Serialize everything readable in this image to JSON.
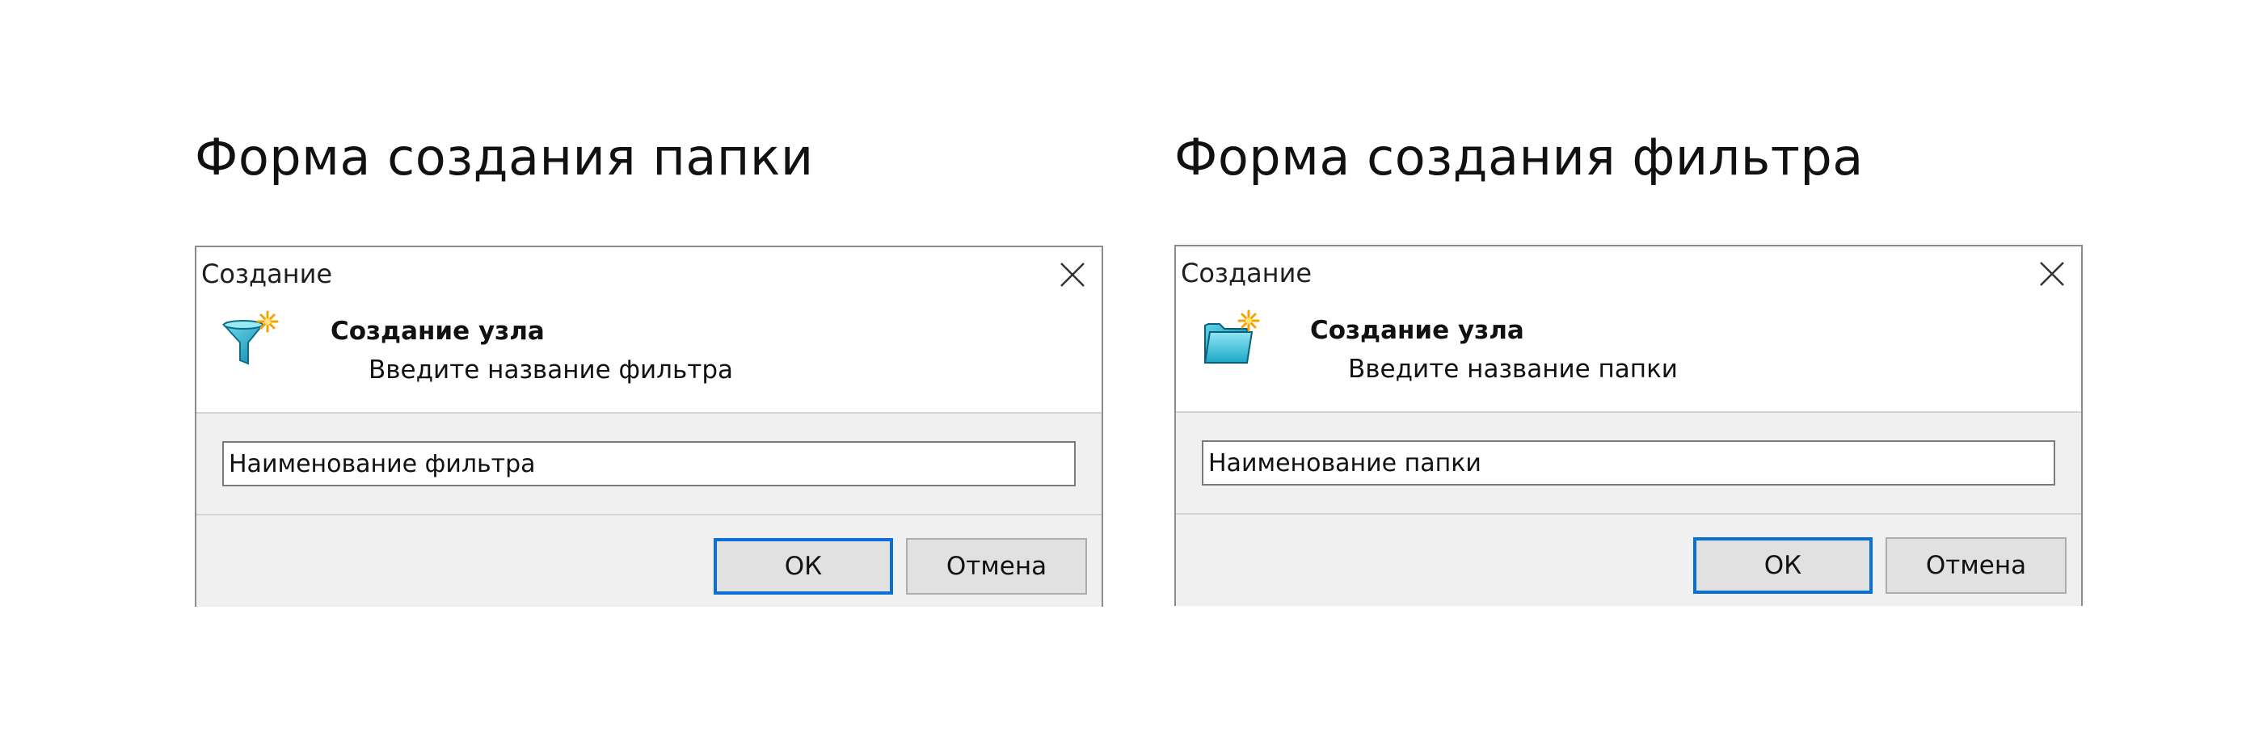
{
  "panels": [
    {
      "heading": "Форма создания папки",
      "dialog": {
        "title": "Создание",
        "header_title": "Создание узла",
        "header_subtitle": "Введите название фильтра",
        "input_value": "Наименование фильтра",
        "ok_label": "ОК",
        "cancel_label": "Отмена",
        "icon": "filter-icon"
      }
    },
    {
      "heading": "Форма создания фильтра",
      "dialog": {
        "title": "Создание",
        "header_title": "Создание узла",
        "header_subtitle": "Введите название папки",
        "input_value": "Наименование папки",
        "ok_label": "ОК",
        "cancel_label": "Отмена",
        "icon": "folder-icon"
      }
    }
  ],
  "colors": {
    "accent_border": "#0a6fd6",
    "icon_teal": "#1ba7c6",
    "spark": "#f5a300",
    "dialog_bg": "#f0f0f0"
  }
}
